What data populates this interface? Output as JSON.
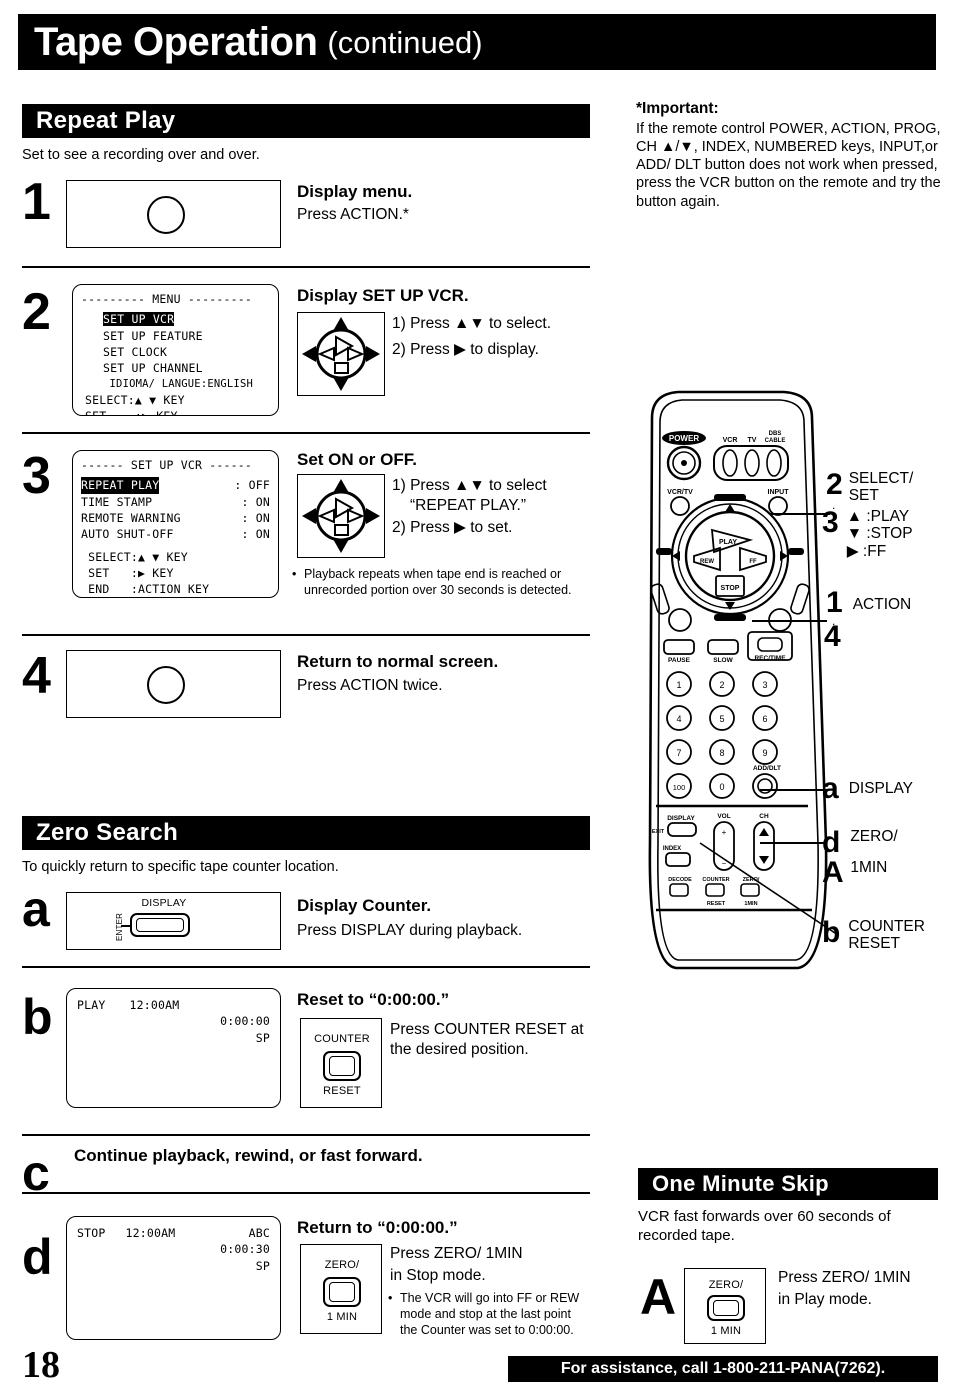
{
  "header": {
    "title_main": "Tape Operation",
    "title_continued": "(continued)"
  },
  "important": {
    "heading": "*Important:",
    "body": "If the remote control POWER, ACTION, PROG, CH ▲/▼, INDEX, NUMBERED keys, INPUT,or ADD/ DLT button does not work when pressed, press the VCR button on the remote and try the button again."
  },
  "repeat_play": {
    "section_title": "Repeat Play",
    "subtitle": "Set to see a recording over and over.",
    "steps": [
      {
        "num": "1",
        "title": "Display menu.",
        "body": "Press ACTION.*"
      },
      {
        "num": "2",
        "title": "Display SET UP VCR.",
        "line1": "1) Press ▲▼ to select.",
        "line2": "2) Press ▶ to display.",
        "osd": {
          "header": "--------- MENU ---------",
          "items": [
            {
              "label": "SET UP VCR",
              "highlight": true
            },
            {
              "label": "SET UP FEATURE",
              "highlight": false
            },
            {
              "label": "SET CLOCK",
              "highlight": false
            },
            {
              "label": "SET UP CHANNEL",
              "highlight": false
            },
            {
              "label": " IDIOMA/ LANGUE:ENGLISH",
              "highlight": false
            }
          ],
          "footer": [
            "SELECT:▲ ▼ KEY",
            "SET    :▶ KEY"
          ]
        }
      },
      {
        "num": "3",
        "title": "Set ON or OFF.",
        "line1": "1) Press ▲▼ to select",
        "line1b": "“REPEAT PLAY.”",
        "line2": "2) Press ▶ to set.",
        "note": "Playback repeats when tape end is reached or unrecorded portion over 30 seconds is detected.",
        "osd": {
          "header": "------ SET UP VCR ------",
          "rows": [
            {
              "label": "REPEAT PLAY",
              "value": ": OFF",
              "highlight": true
            },
            {
              "label": "TIME STAMP",
              "value": ": ON",
              "highlight": false
            },
            {
              "label": "REMOTE WARNING",
              "value": ": ON",
              "highlight": false
            },
            {
              "label": "AUTO SHUT-OFF",
              "value": ": ON",
              "highlight": false
            }
          ],
          "footer": [
            " SELECT:▲ ▼ KEY",
            " SET   :▶ KEY",
            " END   :ACTION KEY"
          ]
        }
      },
      {
        "num": "4",
        "title": "Return to normal screen.",
        "body": "Press ACTION twice."
      }
    ]
  },
  "zero_search": {
    "section_title": "Zero Search",
    "subtitle": "To quickly return to specific tape counter location.",
    "steps": [
      {
        "num": "a",
        "title": "Display Counter.",
        "body": "Press DISPLAY during playback.",
        "button_top_label": "DISPLAY",
        "button_side_label": "ENTER"
      },
      {
        "num": "b",
        "title": "Reset to “0:00:00.”",
        "body": "Press COUNTER RESET at the desired position.",
        "button_top_label": "COUNTER",
        "button_bottom_label": "RESET",
        "osd": {
          "mode": "PLAY",
          "clock": "12:00AM",
          "channel": "",
          "counter": "0:00:00",
          "speed": "SP"
        }
      },
      {
        "num": "c",
        "title": "Continue playback, rewind, or fast forward."
      },
      {
        "num": "d",
        "title": "Return to “0:00:00.”",
        "body_line1": "Press ZERO/ 1MIN",
        "body_line2": "in Stop mode.",
        "note": "The VCR will go into FF or REW mode and stop at the last point the Counter was set to 0:00:00.",
        "button_top_label": "ZERO/",
        "button_bottom_label": "1 MIN",
        "osd": {
          "mode": "STOP",
          "clock": "12:00AM",
          "channel": "ABC",
          "counter": "0:00:30",
          "speed": "SP"
        }
      }
    ]
  },
  "one_minute_skip": {
    "section_title": "One Minute Skip",
    "subtitle": "VCR fast forwards over 60 seconds of recorded tape.",
    "step": {
      "num": "A",
      "body_line1": "Press ZERO/ 1MIN",
      "body_line2": "in Play mode.",
      "button_top_label": "ZERO/",
      "button_bottom_label": "1 MIN"
    }
  },
  "remote": {
    "buttons": {
      "power": "POWER",
      "vcr": "VCR",
      "tv": "TV",
      "dbs_cable": "DBS CABLE",
      "vcr_tv": "VCR/TV",
      "input": "INPUT",
      "play": "PLAY",
      "rewind": "REW",
      "ff": "FF",
      "stop": "STOP",
      "pause": "PAUSE",
      "slow": "SLOW",
      "rec_time": "REC/TIME",
      "numbers": [
        "1",
        "2",
        "3",
        "4",
        "5",
        "6",
        "7",
        "8",
        "9",
        "100",
        "0"
      ],
      "add_dlt": "ADD/DLT",
      "display": "DISPLAY",
      "index": "INDEX",
      "vol": "VOL",
      "ch": "CH",
      "counter_reset": "COUNTER RESET",
      "zero_1min": "ZERO/ 1MIN"
    },
    "callouts": [
      {
        "key": "2",
        "lines": [
          "SELECT/",
          "SET"
        ]
      },
      {
        "key": "3",
        "lines": [
          "▲ :PLAY",
          "▼ :STOP",
          "▶ :FF"
        ]
      },
      {
        "key": "1",
        "lines": [
          "ACTION"
        ]
      },
      {
        "key": "4",
        "lines": []
      },
      {
        "key": "a",
        "lines": [
          "DISPLAY"
        ]
      },
      {
        "key": "d",
        "lines": [
          "ZERO/",
          "1MIN"
        ]
      },
      {
        "key": "A",
        "lines": []
      },
      {
        "key": "b",
        "lines": [
          "COUNTER",
          "RESET"
        ]
      }
    ]
  },
  "footer": {
    "page_number": "18",
    "assistance": "For assistance, call 1-800-211-PANA(7262)."
  }
}
